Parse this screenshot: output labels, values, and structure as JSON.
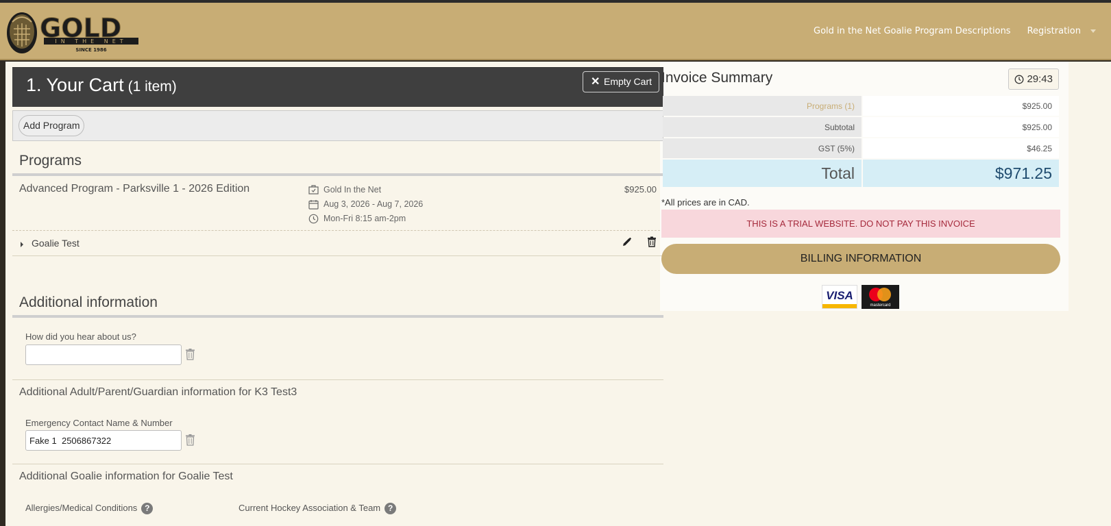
{
  "header": {
    "logo": {
      "word": "GOLD",
      "sub": "IN THE NET",
      "since": "SINCE 1986"
    },
    "nav": [
      {
        "label": "Gold in the Net Goalie Program Descriptions"
      },
      {
        "label": "Registration"
      }
    ]
  },
  "cart": {
    "title": "1. Your Cart",
    "count": "(1 item)",
    "empty_label": "Empty Cart",
    "add_program_label": "Add Program"
  },
  "programs": {
    "title": "Programs",
    "items": [
      {
        "name": "Advanced Program - Parksville 1 - 2026 Edition",
        "organization": "Gold In the Net",
        "dates": "Aug 3, 2026 - Aug 7, 2026",
        "schedule": "Mon-Fri 8:15 am-2pm",
        "price": "$925.00",
        "participant": "Goalie Test"
      }
    ]
  },
  "additional": {
    "title": "Additional information",
    "hear_label": "How did you hear about us?",
    "hear_value": "",
    "guardian_title": "Additional Adult/Parent/Guardian information for K3 Test3",
    "emergency_label": "Emergency Contact Name & Number",
    "emergency_value": "Fake 1  2506867322",
    "goalie_title": "Additional Goalie information for Goalie Test",
    "allergies_label": "Allergies/Medical Conditions",
    "hockey_label": "Current Hockey Association & Team",
    "help_glyph": "?"
  },
  "invoice": {
    "title": "Invoice Summary",
    "timer": "29:43",
    "rows": [
      {
        "label": "Programs (1)",
        "value": "$925.00"
      },
      {
        "label": "Subtotal",
        "value": "$925.00"
      },
      {
        "label": "GST (5%)",
        "value": "$46.25"
      }
    ],
    "total_label": "Total",
    "total_value": "$971.25",
    "cad_note": "*All prices are in CAD.",
    "trial_notice": "THIS IS A TRIAL WEBSITE. DO NOT PAY THIS INVOICE",
    "billing_label": "BILLING INFORMATION",
    "cards": {
      "visa": "VISA",
      "mastercard": "mastercard"
    }
  },
  "colors": {
    "gold": "#c8ad75",
    "dark": "#3f3f3f",
    "page": "#f9f5ea",
    "alert": "#f8d7dc",
    "total_bg": "#d6eef6"
  }
}
